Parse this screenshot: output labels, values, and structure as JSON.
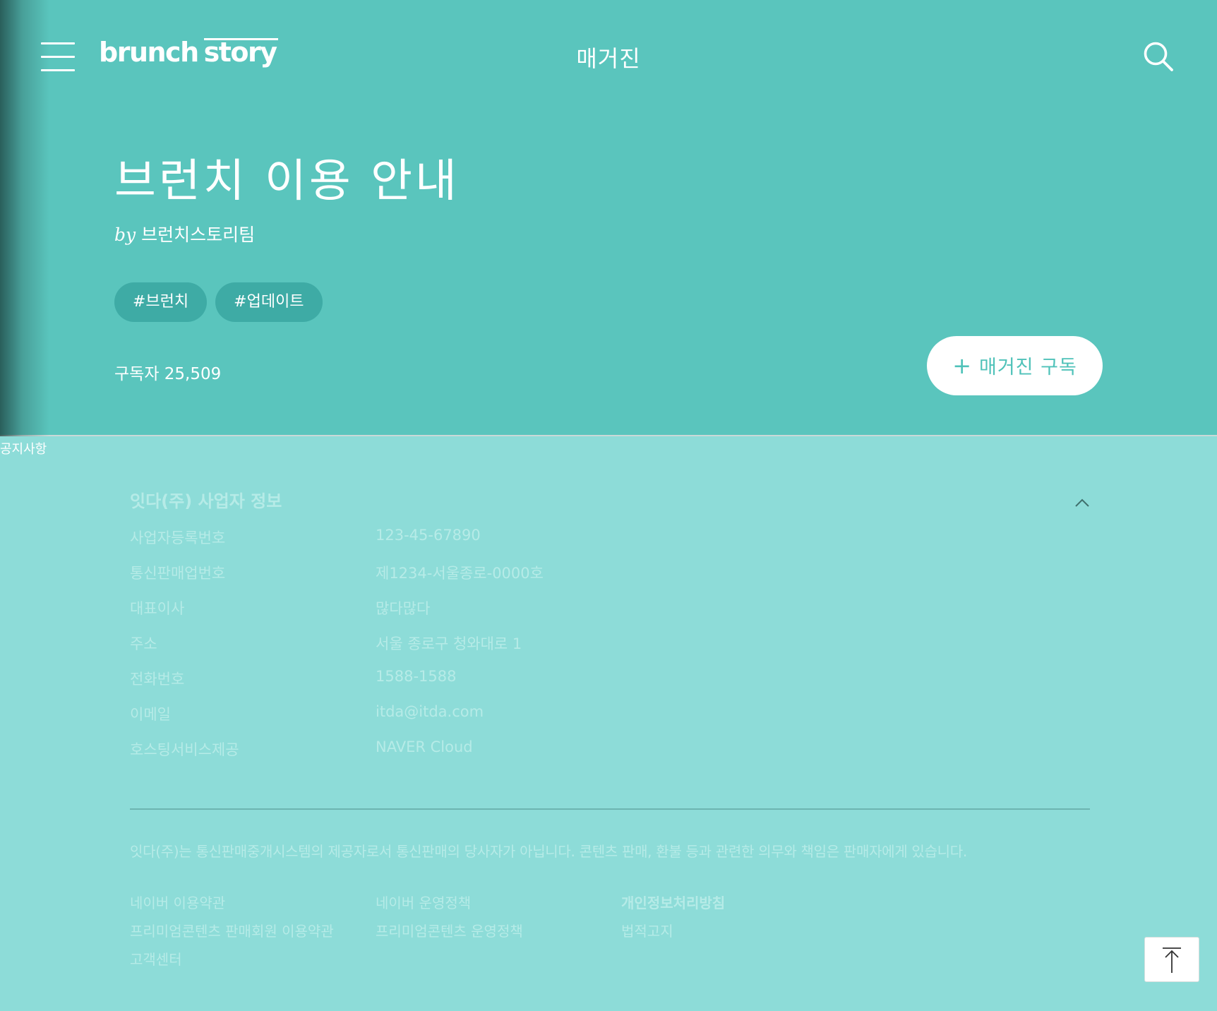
{
  "header": {
    "logo_primary": "brunch",
    "logo_secondary": "story",
    "nav_title": "매거진",
    "menu_icon": "hamburger-menu-icon",
    "search_icon": "search-icon"
  },
  "magazine": {
    "title": "브런치 이용 안내",
    "by_label": "by",
    "author": "브런치스토리팀",
    "tags": [
      "#브런치",
      "#업데이트"
    ],
    "subscriber_text": "구독자 25,509",
    "subscribe_plus": "+",
    "subscribe_label": "매거진 구독"
  },
  "notice_label": "공지사항",
  "business": {
    "title": "잇다(주) 사업자 정보",
    "collapse_icon": "chevron-up-icon",
    "rows": [
      {
        "label": "사업자등록번호",
        "value": "123-45-67890"
      },
      {
        "label": "통신판매업번호",
        "value": "제1234-서울종로-0000호"
      },
      {
        "label": "대표이사",
        "value": "많다많다"
      },
      {
        "label": "주소",
        "value": "서울 종로구 청와대로 1"
      },
      {
        "label": "전화번호",
        "value": "1588-1588"
      },
      {
        "label": "이메일",
        "value": "itda@itda.com"
      },
      {
        "label": "호스팅서비스제공",
        "value": "NAVER Cloud"
      }
    ]
  },
  "footer": {
    "disclaimer": "잇다(주)는 통신판매중개시스템의 제공자로서 통신판매의 당사자가 아닙니다. 콘텐츠 판매, 환불 등과 관련한 의무와 책임은 판매자에게 있습니다.",
    "links": {
      "naver_terms": "네이버 이용약관",
      "naver_policy": "네이버 운영정책",
      "privacy_policy": "개인정보처리방침",
      "premium_seller_terms": "프리미엄콘텐츠 판매회원 이용약관",
      "premium_policy": "프리미엄콘텐츠 운영정책",
      "legal_notice": "법적고지",
      "customer_center": "고객센터"
    },
    "top_button_icon": "arrow-up-to-top-icon"
  },
  "colors": {
    "cover_bg": "#5ac5bd",
    "footer_bg": "#8ddcd8",
    "accent": "#4fc2b9",
    "footer_text": "#b6ebe7"
  }
}
